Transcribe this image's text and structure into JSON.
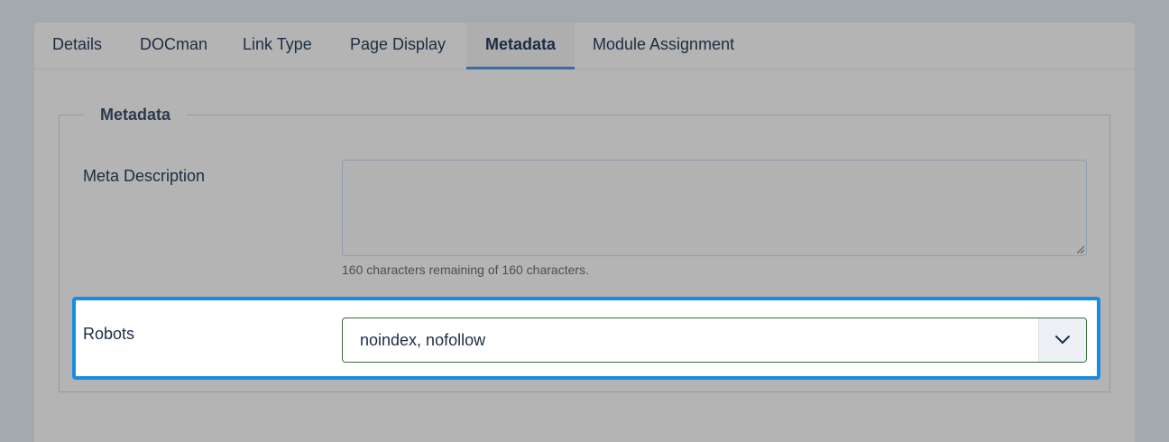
{
  "tabs": [
    {
      "label": "Details"
    },
    {
      "label": "DOCman"
    },
    {
      "label": "Link Type"
    },
    {
      "label": "Page Display"
    },
    {
      "label": "Metadata",
      "active": true
    },
    {
      "label": "Module Assignment"
    }
  ],
  "fieldset": {
    "legend": "Metadata"
  },
  "meta_description": {
    "label": "Meta Description",
    "value": "",
    "hint": "160 characters remaining of 160 characters."
  },
  "robots": {
    "label": "Robots",
    "selected": "noindex, nofollow"
  },
  "icons": {
    "dropdown": "chevron-down-icon",
    "resize": "resize-grip-icon"
  },
  "colors": {
    "highlight": "#1a8ce0",
    "active_tab_underline": "#3b6aa6",
    "select_border": "#3a6a3a"
  }
}
